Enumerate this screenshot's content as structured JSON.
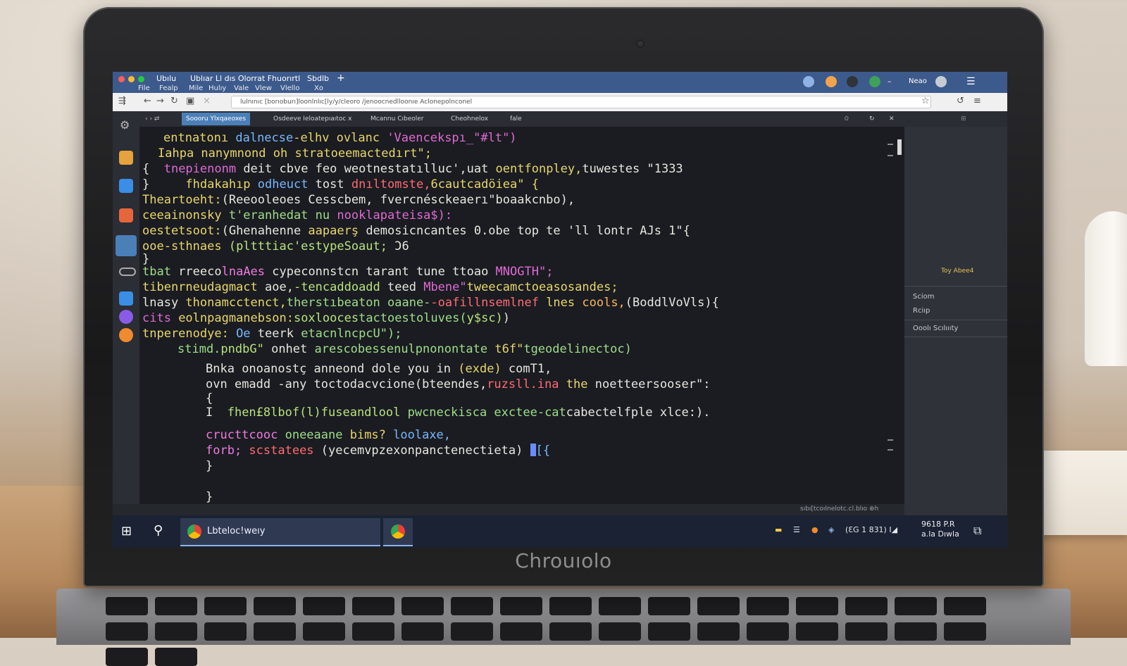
{
  "device": {
    "brand": "Chrouıolo"
  },
  "window": {
    "title_tabs": [
      "Ubılu",
      "Ublıar Ll dıs Olorrat Fhuorırtl",
      "Sbdlb",
      "+"
    ],
    "menu": [
      "File",
      "Fealp",
      "Mile",
      "Hulıy",
      "Vale",
      "Vlew",
      "Vlello",
      "Xo"
    ],
    "user": "Neao",
    "address": "lulnınıc [borıoburı]loonlnlıc[ly/y/cleoro /jenoocnedlloonıe Aclonepolnconel"
  },
  "tabs": [
    {
      "label": "Soooru Ylxqaeoxes",
      "active": true
    },
    {
      "label": "Osdeeve Ieloatepıaıtoc x"
    },
    {
      "label": "Mcannu Cıbeoler"
    },
    {
      "label": "Cheohnelox"
    },
    {
      "label": "fale"
    }
  ],
  "code_lines": [
    {
      "indent": 30,
      "segs": [
        [
          "entnatonı ",
          "y"
        ],
        [
          "dalnecse",
          "b"
        ],
        [
          "-elhv ovlanc ",
          "y"
        ],
        [
          "'Vaencekspı_\"#lt\")",
          "p"
        ]
      ]
    },
    {
      "indent": 22,
      "segs": [
        [
          "Iahpa nanymnond oh stratoeemactedırt\";",
          "y"
        ]
      ]
    },
    {
      "indent": 0,
      "segs": [
        [
          "{  ",
          "w"
        ],
        [
          "tnepienonm ",
          "p"
        ],
        [
          "deit cbve feo weotnestatılluc',uat ",
          "w"
        ],
        [
          "oentfonpley,",
          "y"
        ],
        [
          "tuwestes \"1333",
          "w"
        ]
      ]
    },
    {
      "indent": 0,
      "segs": [
        [
          "}     ",
          "w"
        ],
        [
          "fhdakahıp ",
          "y"
        ],
        [
          "odheuct ",
          "b"
        ],
        [
          "tost ",
          "w"
        ],
        [
          "dnıltomste,",
          "r"
        ],
        [
          "6cautcadöiea\" {",
          "y"
        ]
      ]
    },
    {
      "indent": 0,
      "segs": [
        [
          "Theartoeht:",
          "y"
        ],
        [
          "(Reeooleoes Cesscbem, fvercnésckeaerı\"boaakcnbo),",
          "w"
        ]
      ]
    },
    {
      "indent": 0,
      "segs": [
        [
          "ceeainonsky ",
          "y"
        ],
        [
          "t'eranhedat nu ",
          "g"
        ],
        [
          "nooklapateisa$):",
          "p"
        ]
      ]
    },
    {
      "indent": 0,
      "segs": [
        [
          "oestetsoot:",
          "y"
        ],
        [
          "(Ghenahenne ",
          "w"
        ],
        [
          "aapaerş ",
          "y"
        ],
        [
          "demosicncantes 0.obe top te 'll lontr AJs 1\"{",
          "w"
        ]
      ]
    },
    {
      "indent": 0,
      "segs": [
        [
          "ooe-sthnaes ",
          "y"
        ],
        [
          "(pltttiac'estypeSoaut; ",
          "l"
        ],
        [
          "Ɔ6",
          "w"
        ]
      ]
    },
    {
      "indent": 0,
      "segs": [
        [
          "}",
          "w"
        ]
      ]
    },
    {
      "indent": 0,
      "segs": [
        [
          "tbat ",
          "g"
        ],
        [
          "rreeco",
          "w"
        ],
        [
          "lnaAes ",
          "pk"
        ],
        [
          "cypeconnstcn tarant tune ttoao ",
          "w"
        ],
        [
          "MNOGTH\";",
          "p"
        ]
      ]
    },
    {
      "indent": 0,
      "segs": [
        [
          "tibenrneudagmact ",
          "y"
        ],
        [
          "aoe,",
          "w"
        ],
        [
          "-tencaddoadd ",
          "l"
        ],
        [
          "teed ",
          "w"
        ],
        [
          "Mbene\"",
          "p"
        ],
        [
          "tweecamctoeasosandes;",
          "y"
        ]
      ]
    },
    {
      "indent": 0,
      "segs": [
        [
          "lnasy ",
          "w"
        ],
        [
          "thonamcctenct,",
          "y"
        ],
        [
          "therstıbeaton oaane-",
          "g"
        ],
        [
          "-oafillnsemlnef ",
          "r"
        ],
        [
          "lnes ",
          "y"
        ],
        [
          "cools,",
          "o"
        ],
        [
          "(BoddlVoVls){",
          "w"
        ]
      ]
    },
    {
      "indent": 0,
      "segs": [
        [
          "cits ",
          "p"
        ],
        [
          "eolnpagmanebson:",
          "y"
        ],
        [
          "soxlooces",
          "l"
        ],
        [
          "tactoestoluves(",
          "g"
        ],
        [
          "y$sc)",
          "l"
        ],
        [
          ")",
          "w"
        ]
      ]
    },
    {
      "indent": 0,
      "segs": [
        [
          "tnperenodye: ",
          "y"
        ],
        [
          "Oe ",
          "b"
        ],
        [
          "teerk ",
          "w"
        ],
        [
          "etacnlncpcU\");",
          "g"
        ]
      ]
    },
    {
      "indent": 50,
      "segs": [
        [
          "stimd.",
          "g"
        ],
        [
          "pndbG\" ",
          "l"
        ],
        [
          "onhet ",
          "w"
        ],
        [
          "arescobessenulpnonontate ",
          "g"
        ],
        [
          "t6f\"",
          "y"
        ],
        [
          "tgeodelinectoc)",
          "g"
        ]
      ]
    },
    {
      "indent": 90,
      "segs": [
        [
          "Bnka ",
          "w"
        ],
        [
          "onoanostç ",
          "w"
        ],
        [
          "anneond ",
          "w"
        ],
        [
          "dole you in ",
          "w"
        ],
        [
          "(exde) ",
          "y"
        ],
        [
          "comT1,",
          "w"
        ]
      ]
    },
    {
      "indent": 90,
      "segs": [
        [
          "ovn ",
          "w"
        ],
        [
          "emadd ",
          "w"
        ],
        [
          "-any toctodacvcione(bteendes,",
          "w"
        ],
        [
          "ruzsll.ina ",
          "r"
        ],
        [
          "the ",
          "y"
        ],
        [
          "noetteersooser\":",
          "w"
        ]
      ]
    },
    {
      "indent": 90,
      "segs": [
        [
          "{",
          "w"
        ]
      ]
    },
    {
      "indent": 90,
      "segs": [
        [
          "I  ",
          "w"
        ],
        [
          "fhen£8lbof(l)fuseandlool ",
          "l"
        ],
        [
          "pwcneckisca ",
          "g"
        ],
        [
          "exctee-cat",
          "g"
        ],
        [
          "cabectelfple xlce:).",
          "w"
        ]
      ]
    },
    {
      "indent": 90,
      "segs": [
        [
          "cructtcooc ",
          "pk"
        ],
        [
          "oneeaane ",
          "g"
        ],
        [
          "bims? ",
          "y"
        ],
        [
          "loolaxe,",
          "b"
        ]
      ]
    },
    {
      "indent": 90,
      "segs": [
        [
          "forb; ",
          "pk"
        ],
        [
          "scstatees ",
          "r"
        ],
        [
          "(yecemvpzexonpanctenectieta) ",
          "w"
        ],
        [
          "[",
          "b"
        ],
        [
          "{",
          "b"
        ]
      ]
    },
    {
      "indent": 90,
      "segs": [
        [
          "}",
          "w"
        ]
      ]
    },
    {
      "indent": 90,
      "segs": [
        [
          "}",
          "w"
        ]
      ]
    }
  ],
  "right_panel": {
    "top_label": "Toy Abee4",
    "items": [
      "Sciom",
      "Rciıp",
      "Ooolı Scılıııty"
    ]
  },
  "status": {
    "text": "sıbı[tcoıInelotc.cl.blıo   ⊕h"
  },
  "taskbar": {
    "app_label": "Lbteloc!weıy",
    "tray_text": "(ƐG 1 831) I◢",
    "clock_line1": "9618 P.R",
    "clock_line2": "a.la Dıwla"
  },
  "colors": {
    "editor_bg": "#1a1c21",
    "titlebar": "#3d5a8c",
    "taskbar": "#1a2233"
  }
}
